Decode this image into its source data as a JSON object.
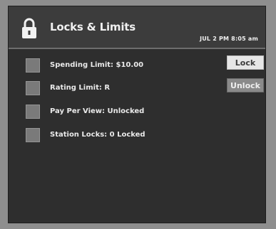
{
  "header": {
    "title": "Locks & Limits",
    "timestamp": "JUL 2 PM 8:05 am"
  },
  "items": [
    {
      "label": "Spending Limit: $10.00"
    },
    {
      "label": "Rating Limit: R"
    },
    {
      "label": "Pay Per View: Unlocked"
    },
    {
      "label": "Station Locks: 0 Locked"
    }
  ],
  "buttons": {
    "lock_label": "Lock",
    "unlock_label": "Unlock"
  },
  "colors": {
    "panel": "#2e2e2e",
    "header": "#3c3c3c",
    "checkbox": "#7a7a7a",
    "bezel": "#8e8e8e"
  },
  "icons": {
    "header_icon": "padlock-icon"
  }
}
